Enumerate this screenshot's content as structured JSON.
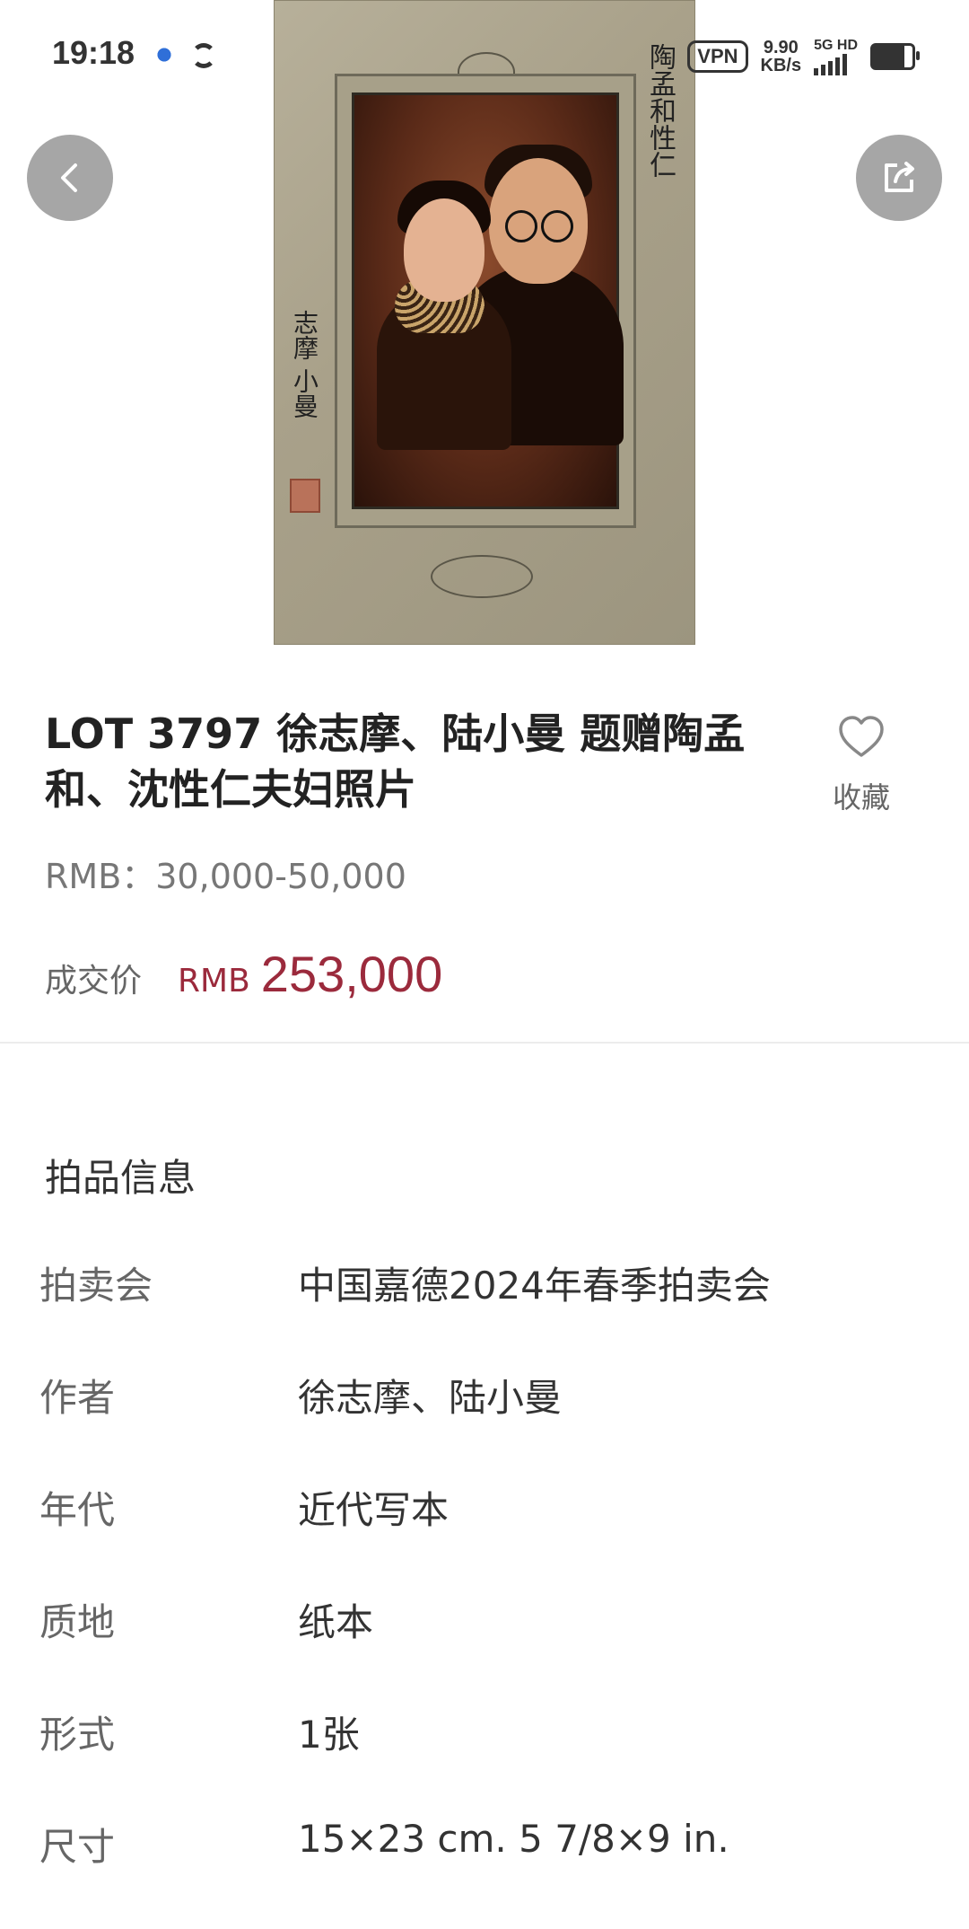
{
  "status_bar": {
    "time": "19:18",
    "vpn": "VPN",
    "speed_value": "9.90",
    "speed_unit": "KB/s",
    "network": "5G HD"
  },
  "hero": {
    "calligraphy_right": "陶孟和性仁",
    "calligraphy_left": "志摩 小曼"
  },
  "lot": {
    "title": "LOT 3797 徐志摩、陆小曼  题赠陶孟和、沈性仁夫妇照片",
    "favorite_label": "收藏",
    "estimate": "RMB：30,000-50,000",
    "deal_label": "成交价",
    "deal_currency": "RMB",
    "deal_price": "253,000"
  },
  "info": {
    "section_title": "拍品信息",
    "rows": [
      {
        "label": "拍卖会",
        "value": "中国嘉德2024年春季拍卖会"
      },
      {
        "label": "作者",
        "value": "徐志摩、陆小曼"
      },
      {
        "label": "年代",
        "value": "近代写本"
      },
      {
        "label": "质地",
        "value": "纸本"
      },
      {
        "label": "形式",
        "value": "1张"
      },
      {
        "label": "尺寸",
        "value": "15×23 cm. 5 7/8×9 in."
      }
    ]
  },
  "icons": {
    "back": "chevron-left-icon",
    "share": "share-icon",
    "favorite": "heart-icon"
  },
  "colors": {
    "price_accent": "#9b2a3c",
    "fab_background": "#969696"
  }
}
